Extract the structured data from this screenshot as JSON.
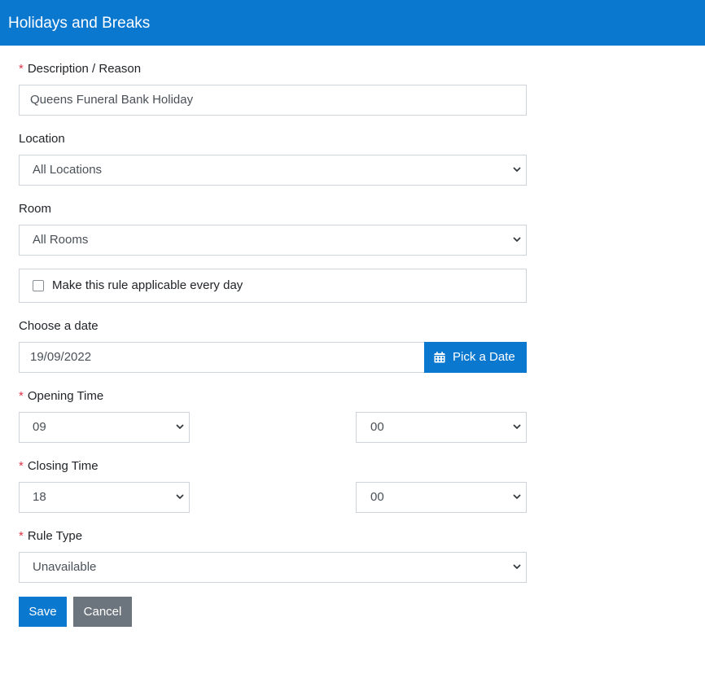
{
  "header": {
    "title": "Holidays and Breaks"
  },
  "required_mark": "*",
  "description": {
    "label": "Description / Reason",
    "value": "Queens Funeral Bank Holiday"
  },
  "location": {
    "label": "Location",
    "value": "All Locations"
  },
  "room": {
    "label": "Room",
    "value": "All Rooms"
  },
  "every_day": {
    "label": "Make this rule applicable every day",
    "checked": false
  },
  "date": {
    "label": "Choose a date",
    "value": "19/09/2022",
    "button_label": "Pick a Date"
  },
  "opening_time": {
    "label": "Opening Time",
    "hour": "09",
    "minute": "00"
  },
  "closing_time": {
    "label": "Closing Time",
    "hour": "18",
    "minute": "00"
  },
  "rule_type": {
    "label": "Rule Type",
    "value": "Unavailable"
  },
  "actions": {
    "save_label": "Save",
    "cancel_label": "Cancel"
  },
  "icons": {
    "select_arrow": "chevron-down-icon",
    "date_button": "calendar-icon"
  },
  "colors": {
    "primary": "#0b78d0",
    "secondary": "#6c757d",
    "required": "#dc3545"
  }
}
